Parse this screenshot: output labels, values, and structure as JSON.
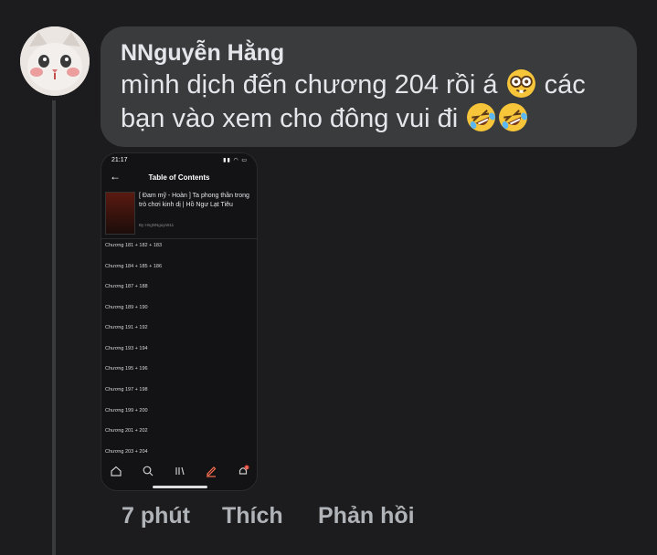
{
  "comment": {
    "author": "NNguyễn Hằng",
    "text_line1": "mình dịch đến chương 204 rồi á",
    "text_line1_tail": "các",
    "text_line2": "bạn vào xem cho đông vui đi",
    "emojis": [
      "nerd-face-emoji",
      "rolling-on-floor-laughing-emoji",
      "rolling-on-floor-laughing-emoji"
    ]
  },
  "screenshot": {
    "status_time": "21:17",
    "header_title": "Table of Contents",
    "book_title": "[ Đam mỹ - Hoàn ] Ta phong thần trong trò chơi kinh dị | Hồ Ngư Lạt Tiêu",
    "book_author": "By HngNNguyn611",
    "chapters": [
      "Chương 181 + 182 + 183",
      "Chương 184 + 185 + 186",
      "Chương 187 + 188",
      "Chương 189 + 190",
      "Chương 191 + 192",
      "Chương 193 + 194",
      "Chương 195 + 196",
      "Chương 197 + 198",
      "Chương 199 + 200",
      "Chương 201 + 202",
      "Chương 203 + 204"
    ],
    "nav": [
      "home-icon",
      "search-icon",
      "library-icon",
      "write-icon",
      "bell-icon"
    ],
    "notification_count": "1",
    "accent_color": "#ff6f4f"
  },
  "actions": {
    "time": "7 phút",
    "like": "Thích",
    "reply": "Phản hồi"
  }
}
